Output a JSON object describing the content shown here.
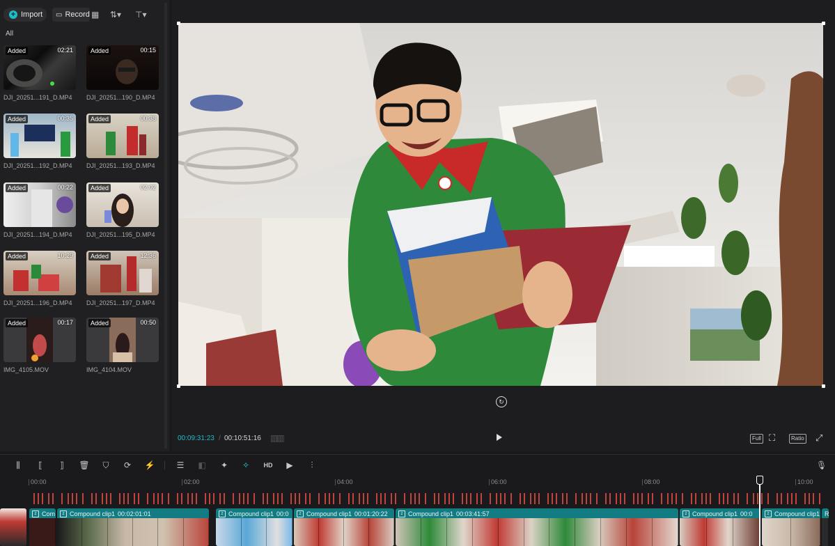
{
  "media_panel": {
    "import_label": "Import",
    "record_label": "Record",
    "filter_label": "All",
    "items": [
      {
        "badge": "Added",
        "duration": "02:21",
        "name": "DJI_20251...191_D.MP4"
      },
      {
        "badge": "Added",
        "duration": "00:15",
        "name": "DJI_20251...190_D.MP4"
      },
      {
        "badge": "Added",
        "duration": "00:35",
        "name": "DJI_20251...192_D.MP4"
      },
      {
        "badge": "Added",
        "duration": "00:38",
        "name": "DJI_20251...193_D.MP4"
      },
      {
        "badge": "Added",
        "duration": "00:22",
        "name": "DJI_20251...194_D.MP4"
      },
      {
        "badge": "Added",
        "duration": "02:02",
        "name": "DJI_20251...195_D.MP4"
      },
      {
        "badge": "Added",
        "duration": "10:29",
        "name": "DJI_20251...196_D.MP4"
      },
      {
        "badge": "Added",
        "duration": "12:36",
        "name": "DJI_20251...197_D.MP4"
      },
      {
        "badge": "Added",
        "duration": "00:17",
        "name": "IMG_4105.MOV"
      },
      {
        "badge": "Added",
        "duration": "00:50",
        "name": "IMG_4104.MOV"
      }
    ]
  },
  "player": {
    "current_time": "00:09:31:23",
    "separator": "/",
    "total_time": "00:10:51:16",
    "full_label": "Full",
    "ratio_label": "Ratio"
  },
  "timeline": {
    "ruler": [
      "00:00",
      "02:00",
      "04:00",
      "06:00",
      "08:00",
      "10:00"
    ],
    "playhead_progress": 0.877,
    "clips": [
      {
        "label": "Com",
        "time": ""
      },
      {
        "label": "Compound clip1",
        "time": "00:02:01:01"
      },
      {
        "label": "Compound clip1",
        "time": "00:0"
      },
      {
        "label": "Compound clip1",
        "time": "00:01:20:22"
      },
      {
        "label": "Compound clip1",
        "time": "00:03:41:57"
      },
      {
        "label": "Compound clip1",
        "time": "00:0"
      },
      {
        "label": "Compound clip1",
        "time": ""
      },
      {
        "label": "R",
        "time": ""
      }
    ]
  },
  "icons": {
    "toolbar": [
      "split-icon",
      "trim-left-icon",
      "trim-right-icon",
      "delete-icon",
      "mark-icon",
      "crop-icon",
      "auto-reframe-icon",
      "captions-icon",
      "freeze-icon",
      "ai-avatar-icon",
      "magic-edit-icon",
      "hd-icon",
      "export-frame-icon",
      "audio-wave-icon",
      "mic-icon"
    ]
  },
  "colors": {
    "accent": "#1fbcc8",
    "clip": "#137c82",
    "beat_marker": "#c0443c"
  }
}
